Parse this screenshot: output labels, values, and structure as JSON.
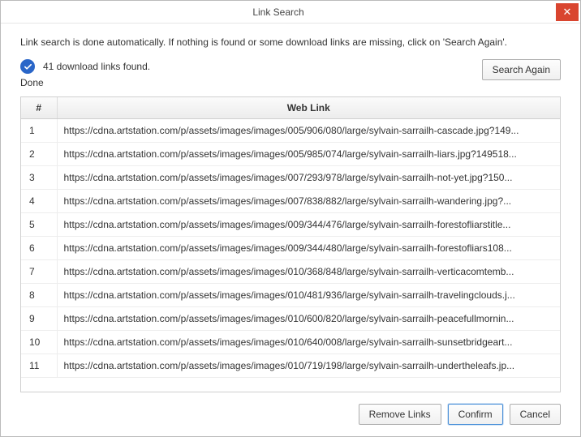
{
  "window": {
    "title": "Link Search",
    "close_glyph": "✕"
  },
  "description": "Link search is done automatically. If nothing is found or some download links are missing, click on 'Search Again'.",
  "status": {
    "summary": "41 download links found.",
    "done_label": "Done"
  },
  "buttons": {
    "search_again": "Search Again",
    "remove_links": "Remove Links",
    "confirm": "Confirm",
    "cancel": "Cancel"
  },
  "table": {
    "headers": {
      "num": "#",
      "link": "Web Link"
    },
    "rows": [
      {
        "n": "1",
        "url": "https://cdna.artstation.com/p/assets/images/images/005/906/080/large/sylvain-sarrailh-cascade.jpg?149..."
      },
      {
        "n": "2",
        "url": "https://cdna.artstation.com/p/assets/images/images/005/985/074/large/sylvain-sarrailh-liars.jpg?149518..."
      },
      {
        "n": "3",
        "url": "https://cdna.artstation.com/p/assets/images/images/007/293/978/large/sylvain-sarrailh-not-yet.jpg?150..."
      },
      {
        "n": "4",
        "url": "https://cdna.artstation.com/p/assets/images/images/007/838/882/large/sylvain-sarrailh-wandering.jpg?..."
      },
      {
        "n": "5",
        "url": "https://cdna.artstation.com/p/assets/images/images/009/344/476/large/sylvain-sarrailh-forestofliarstitle..."
      },
      {
        "n": "6",
        "url": "https://cdna.artstation.com/p/assets/images/images/009/344/480/large/sylvain-sarrailh-forestofliars108..."
      },
      {
        "n": "7",
        "url": "https://cdna.artstation.com/p/assets/images/images/010/368/848/large/sylvain-sarrailh-verticacomtemb..."
      },
      {
        "n": "8",
        "url": "https://cdna.artstation.com/p/assets/images/images/010/481/936/large/sylvain-sarrailh-travelingclouds.j..."
      },
      {
        "n": "9",
        "url": "https://cdna.artstation.com/p/assets/images/images/010/600/820/large/sylvain-sarrailh-peacefullmornin..."
      },
      {
        "n": "10",
        "url": "https://cdna.artstation.com/p/assets/images/images/010/640/008/large/sylvain-sarrailh-sunsetbridgeart..."
      },
      {
        "n": "11",
        "url": "https://cdna.artstation.com/p/assets/images/images/010/719/198/large/sylvain-sarrailh-undertheleafs.jp..."
      }
    ]
  }
}
